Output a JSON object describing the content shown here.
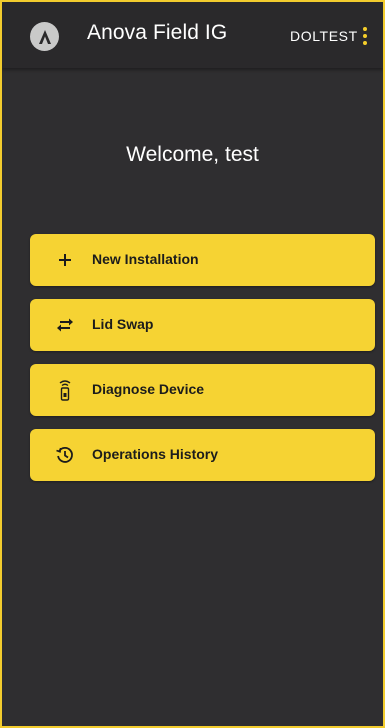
{
  "app": {
    "title": "Anova Field IG",
    "tenant": "DOLTEST",
    "logo_letter": "A"
  },
  "welcome": {
    "text": "Welcome, test"
  },
  "actions": [
    {
      "label": "New Installation",
      "icon": "plus-icon"
    },
    {
      "label": "Lid Swap",
      "icon": "swap-arrows-icon"
    },
    {
      "label": "Diagnose Device",
      "icon": "device-signal-icon"
    },
    {
      "label": "Operations History",
      "icon": "history-icon"
    }
  ],
  "colors": {
    "background": "#2f2e30",
    "app_bar": "#2a292b",
    "accent": "#f6d333",
    "border": "#f2cc2e",
    "text_light": "#ffffff",
    "text_dark": "#1c1c1c"
  }
}
